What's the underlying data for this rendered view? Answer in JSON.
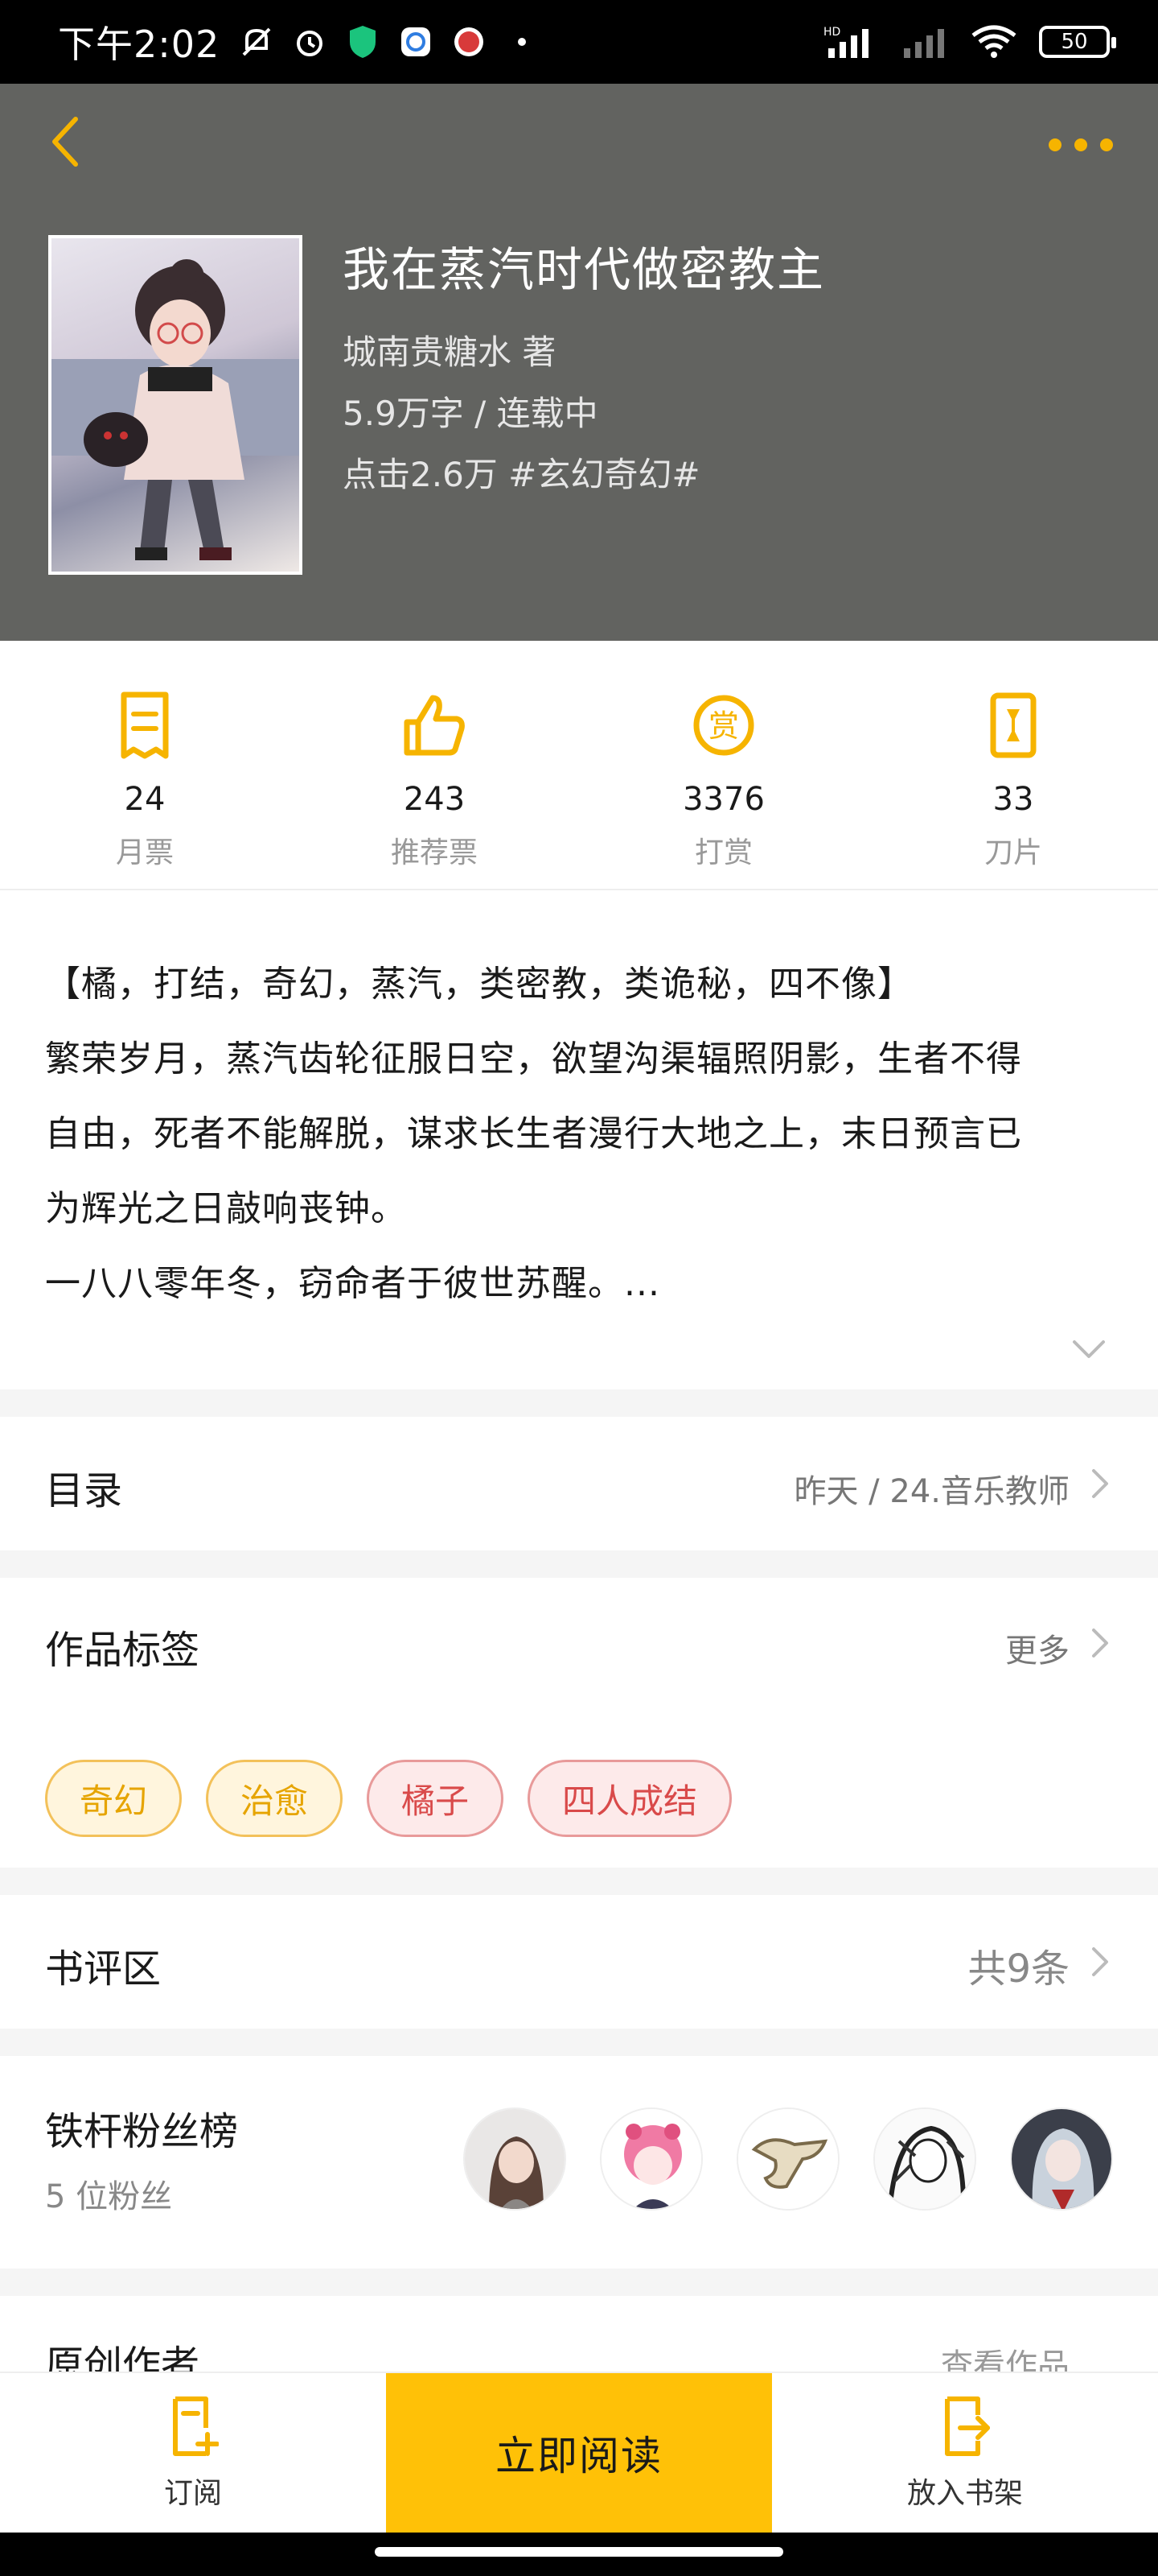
{
  "status_bar": {
    "time": "下午2:02",
    "battery": "50",
    "network": "HD"
  },
  "book": {
    "title": "我在蒸汽时代做密教主",
    "author_line": "城南贵糖水  著",
    "words_status": "5.9万字 / 连载中",
    "clicks_genre": "点击2.6万  #玄幻奇幻#"
  },
  "stats": [
    {
      "value": "24",
      "label": "月票",
      "icon": "monthly-ticket-icon"
    },
    {
      "value": "243",
      "label": "推荐票",
      "icon": "thumbs-up-icon"
    },
    {
      "value": "3376",
      "label": "打赏",
      "icon": "reward-coin-icon"
    },
    {
      "value": "33",
      "label": "刀片",
      "icon": "blade-icon"
    }
  ],
  "intro": {
    "lines": [
      "【橘，打结，奇幻，蒸汽，类密教，类诡秘，四不像】",
      "繁荣岁月，蒸汽齿轮征服日空，欲望沟渠辐照阴影，生者不得",
      "自由，死者不能解脱，谋求长生者漫行大地之上，末日预言已",
      "为辉光之日敲响丧钟。",
      "一八八零年冬，窃命者于彼世苏醒。..."
    ]
  },
  "catalog": {
    "title": "目录",
    "latest": "昨天 / 24.音乐教师"
  },
  "tags_section": {
    "title": "作品标签",
    "more": "更多",
    "tags": [
      {
        "label": "奇幻",
        "color": "#e6a400"
      },
      {
        "label": "治愈",
        "color": "#e6a400"
      },
      {
        "label": "橘子",
        "color": "#d94a4a"
      },
      {
        "label": "四人成结",
        "color": "#d94a4a"
      }
    ]
  },
  "reviews": {
    "title": "书评区",
    "count": "共9条"
  },
  "fans": {
    "title": "铁杆粉丝榜",
    "count": "5 位粉丝"
  },
  "original_author": {
    "title": "原创作者",
    "link": "查看作品"
  },
  "bottom_bar": {
    "subscribe": "订阅",
    "read_now": "立即阅读",
    "add_shelf": "放入书架"
  },
  "colors": {
    "accent": "#f6b400",
    "header_bg": "#626360",
    "read_button": "#ffc107"
  }
}
